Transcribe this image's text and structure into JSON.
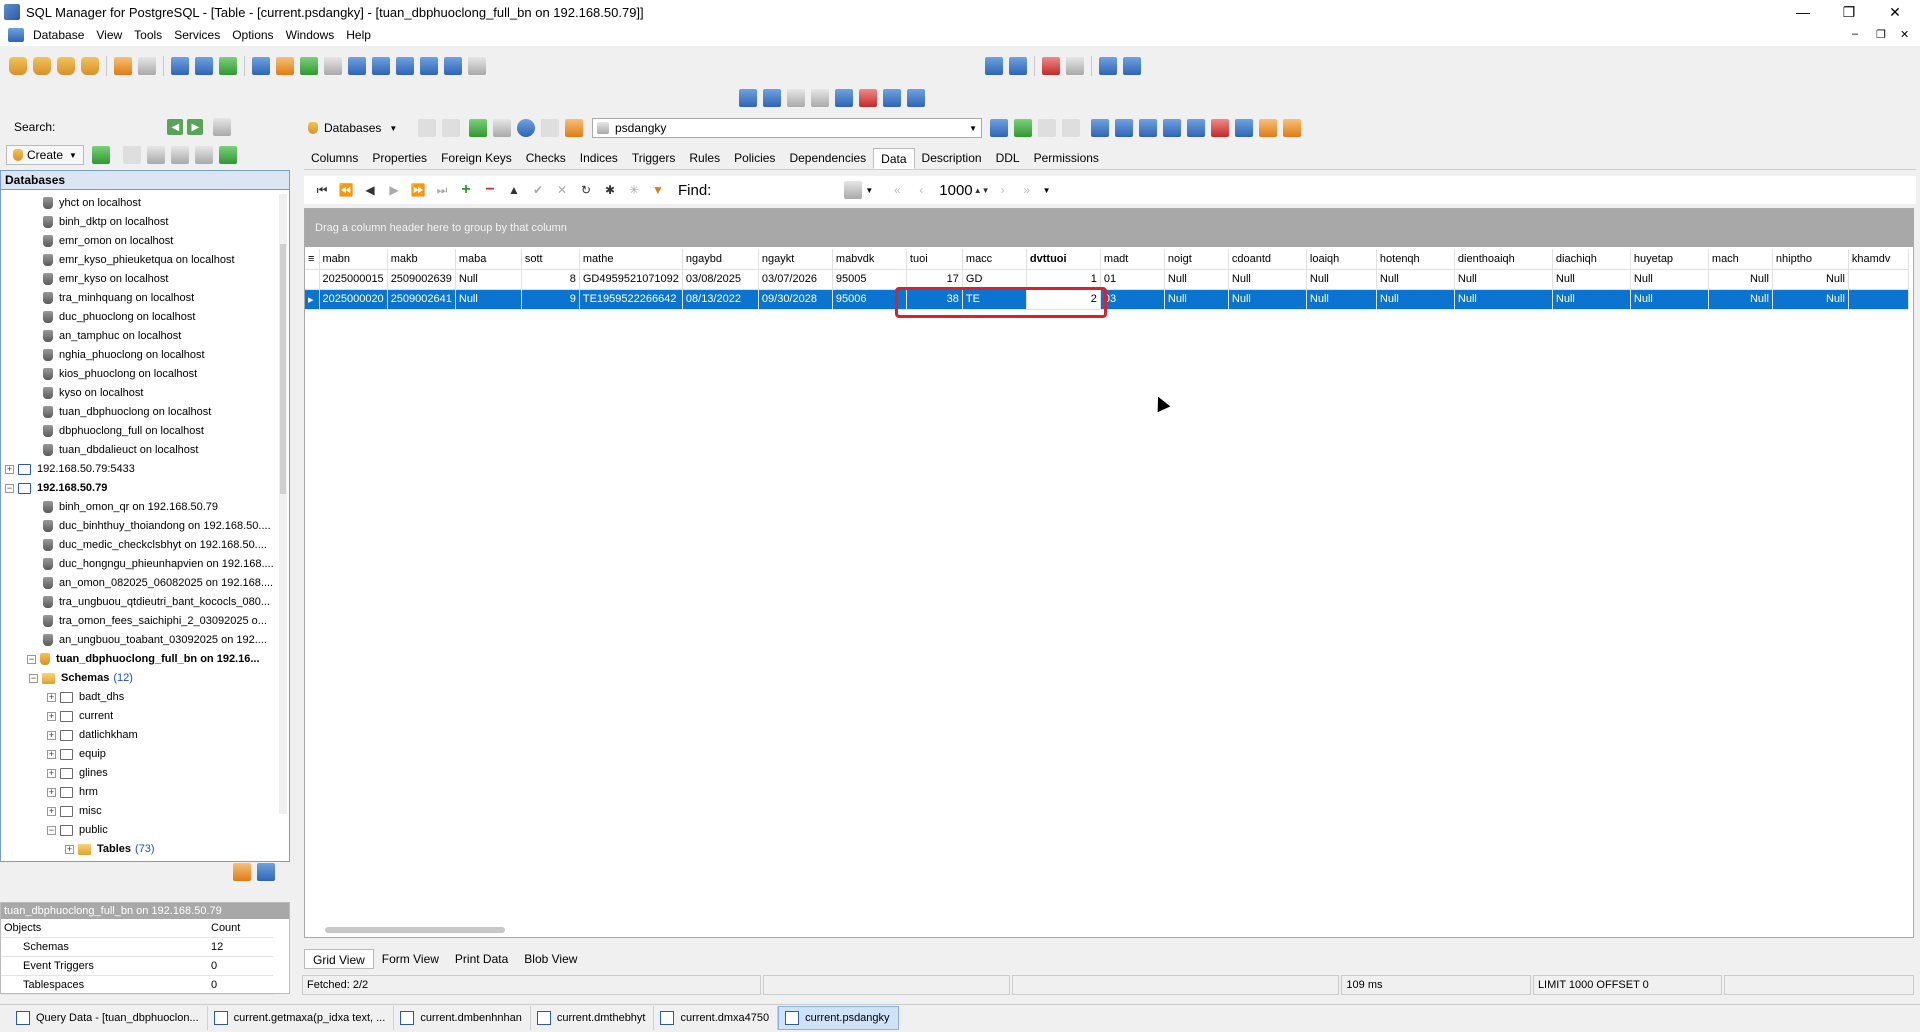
{
  "window": {
    "title": "SQL Manager for PostgreSQL - [Table - [current.psdangky] - [tuan_dbphuoclong_full_bn on 192.168.50.79]]",
    "controls": {
      "minimize": "—",
      "restore": "❐",
      "close": "✕"
    }
  },
  "menu": [
    "Database",
    "View",
    "Tools",
    "Services",
    "Options",
    "Windows",
    "Help"
  ],
  "left": {
    "search_label": "Search:",
    "create_label": "Create",
    "databases_header": "Databases",
    "tree": [
      {
        "label": "yhct on localhost",
        "level": 2,
        "type": "db"
      },
      {
        "label": "binh_dktp on localhost",
        "level": 2,
        "type": "db"
      },
      {
        "label": "emr_omon on localhost",
        "level": 2,
        "type": "db"
      },
      {
        "label": "emr_kyso_phieuketqua on localhost",
        "level": 2,
        "type": "db"
      },
      {
        "label": "emr_kyso on localhost",
        "level": 2,
        "type": "db"
      },
      {
        "label": "tra_minhquang on localhost",
        "level": 2,
        "type": "db"
      },
      {
        "label": "duc_phuoclong on localhost",
        "level": 2,
        "type": "db"
      },
      {
        "label": "an_tamphuc on localhost",
        "level": 2,
        "type": "db"
      },
      {
        "label": "nghia_phuoclong on localhost",
        "level": 2,
        "type": "db"
      },
      {
        "label": "kios_phuoclong on localhost",
        "level": 2,
        "type": "db"
      },
      {
        "label": "kyso on localhost",
        "level": 2,
        "type": "db"
      },
      {
        "label": "tuan_dbphuoclong on localhost",
        "level": 2,
        "type": "db"
      },
      {
        "label": "dbphuoclong_full on localhost",
        "level": 2,
        "type": "db"
      },
      {
        "label": "tuan_dbdalieuct on localhost",
        "level": 2,
        "type": "db"
      },
      {
        "label": "192.168.50.79:5433",
        "level": 1,
        "type": "server",
        "exp": "+"
      },
      {
        "label": "192.168.50.79",
        "level": 1,
        "type": "server",
        "exp": "−",
        "bold": true
      },
      {
        "label": "binh_omon_qr on 192.168.50.79",
        "level": 2,
        "type": "db"
      },
      {
        "label": "duc_binhthuy_thoiandong on 192.168.50....",
        "level": 2,
        "type": "db"
      },
      {
        "label": "duc_medic_checkclsbhyt on 192.168.50....",
        "level": 2,
        "type": "db"
      },
      {
        "label": "duc_hongngu_phieunhapvien on 192.168....",
        "level": 2,
        "type": "db"
      },
      {
        "label": "an_omon_082025_06082025 on 192.168....",
        "level": 2,
        "type": "db"
      },
      {
        "label": "tra_ungbuou_qtdieutri_bant_kococls_080...",
        "level": 2,
        "type": "db"
      },
      {
        "label": "tra_omon_fees_saichiphi_2_03092025 o...",
        "level": 2,
        "type": "db"
      },
      {
        "label": "an_ungbuou_toabant_03092025 on 192....",
        "level": 2,
        "type": "db"
      },
      {
        "label": "tuan_dbphuoclong_full_bn on 192.16...",
        "level": 2,
        "type": "dbsel",
        "exp": "−",
        "bold": true
      },
      {
        "label": "Schemas",
        "count": "(12)",
        "level": 3,
        "type": "folder",
        "exp": "−",
        "bold": true
      },
      {
        "label": "badt_dhs",
        "level": 4,
        "type": "table",
        "exp": "+"
      },
      {
        "label": "current",
        "level": 4,
        "type": "table",
        "exp": "+"
      },
      {
        "label": "datlichkham",
        "level": 4,
        "type": "table",
        "exp": "+"
      },
      {
        "label": "equip",
        "level": 4,
        "type": "table",
        "exp": "+"
      },
      {
        "label": "glines",
        "level": 4,
        "type": "table",
        "exp": "+"
      },
      {
        "label": "hrm",
        "level": 4,
        "type": "table",
        "exp": "+"
      },
      {
        "label": "misc",
        "level": 4,
        "type": "table",
        "exp": "+"
      },
      {
        "label": "public",
        "level": 4,
        "type": "table",
        "exp": "−"
      },
      {
        "label": "Tables",
        "count": "(73)",
        "level": 5,
        "type": "folder",
        "exp": "+",
        "bold": true
      }
    ],
    "objects_title": "tuan_dbphuoclong_full_bn on 192.168.50.79",
    "objects_header": {
      "c1": "Objects",
      "c2": "Count"
    },
    "objects": [
      {
        "name": "Schemas",
        "count": "12"
      },
      {
        "name": "Event Triggers",
        "count": "0"
      },
      {
        "name": "Tablespaces",
        "count": "0"
      }
    ]
  },
  "objbar": {
    "databases_dd": "Databases",
    "table_dd": "psdangky"
  },
  "tabs": [
    "Columns",
    "Properties",
    "Foreign Keys",
    "Checks",
    "Indices",
    "Triggers",
    "Rules",
    "Policies",
    "Dependencies",
    "Data",
    "Description",
    "DDL",
    "Permissions"
  ],
  "active_tab": "Data",
  "navbar": {
    "find_label": "Find:",
    "limit": "1000"
  },
  "grid": {
    "group_hint": "Drag a column header here to group by that column",
    "columns": [
      "mabn",
      "makb",
      "maba",
      "sott",
      "mathe",
      "ngaybd",
      "ngaykt",
      "mabvdk",
      "tuoi",
      "macc",
      "dvttuoi",
      "madt",
      "noigt",
      "cdoantd",
      "loaiqh",
      "hotenqh",
      "dienthoaiqh",
      "diachiqh",
      "huyetap",
      "mach",
      "nhiptho",
      "khamdv"
    ],
    "rows": [
      [
        "2025000015",
        "2509002639",
        "Null",
        "8",
        "GD4959521071092",
        "03/08/2025",
        "03/07/2026",
        "95005",
        "17",
        "GD",
        "1",
        "01",
        "Null",
        "Null",
        "Null",
        "Null",
        "Null",
        "Null",
        "Null",
        "Null",
        "Null",
        ""
      ],
      [
        "2025000020",
        "2509002641",
        "Null",
        "9",
        "TE1959522266642",
        "08/13/2022",
        "09/30/2028",
        "95006",
        "38",
        "TE",
        "2",
        "03",
        "Null",
        "Null",
        "Null",
        "Null",
        "Null",
        "Null",
        "Null",
        "Null",
        "Null",
        ""
      ]
    ]
  },
  "viewtabs": [
    "Grid View",
    "Form View",
    "Print Data",
    "Blob View"
  ],
  "status": {
    "fetched": "Fetched: 2/2",
    "time": "109 ms",
    "limit": "LIMIT 1000 OFFSET 0"
  },
  "taskbar": [
    {
      "label": "Query Data - [tuan_dbphuoclon...",
      "active": false
    },
    {
      "label": "current.getmaxa(p_idxa text, ...",
      "active": false
    },
    {
      "label": "current.dmbenhnhan",
      "active": false
    },
    {
      "label": "current.dmthebhyt",
      "active": false
    },
    {
      "label": "current.dmxa4750",
      "active": false
    },
    {
      "label": "current.psdangky",
      "active": true
    }
  ],
  "colors": {
    "selection": "#0b74d1",
    "highlight_box": "#d8232a",
    "group_panel": "#a8a8a8"
  }
}
